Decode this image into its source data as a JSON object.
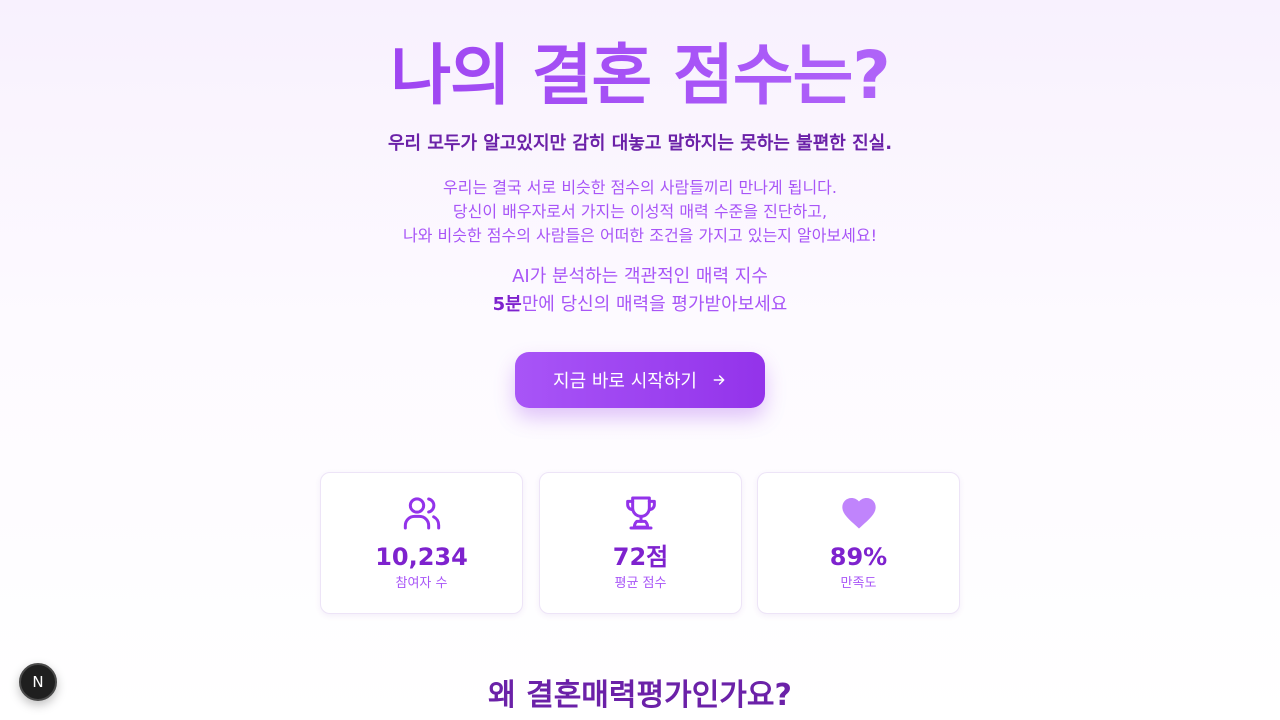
{
  "hero": {
    "title": "나의 결혼 점수는?",
    "subtitle": "우리 모두가 알고있지만 감히 대놓고 말하지는 못하는 불편한 진실.",
    "description": [
      "우리는 결국 서로 비슷한 점수의 사람들끼리 만나게 됩니다.",
      "당신이 배우자로서 가지는 이성적 매력 수준을 진단하고,",
      "나와 비슷한 점수의 사람들은 어떠한 조건을 가지고 있는지 알아보세요!"
    ],
    "highlight_line1": "AI가 분석하는 객관적인 매력 지수",
    "highlight_bold": "5분",
    "highlight_line2_rest": "만에 당신의 매력을 평가받아보세요",
    "cta_label": "지금 바로 시작하기"
  },
  "stats": [
    {
      "icon": "users-icon",
      "value": "10,234",
      "label": "참여자 수"
    },
    {
      "icon": "trophy-icon",
      "value": "72점",
      "label": "평균 점수"
    },
    {
      "icon": "heart-icon",
      "value": "89%",
      "label": "만족도"
    }
  ],
  "section": {
    "title": "왜 결혼매력평가인가요?"
  },
  "devtools": {
    "badge": "N"
  },
  "colors": {
    "accent": "#9333ea",
    "accent_light": "#a855f7",
    "text_dark": "#6b21a8",
    "icon_light": "#c084fc"
  }
}
